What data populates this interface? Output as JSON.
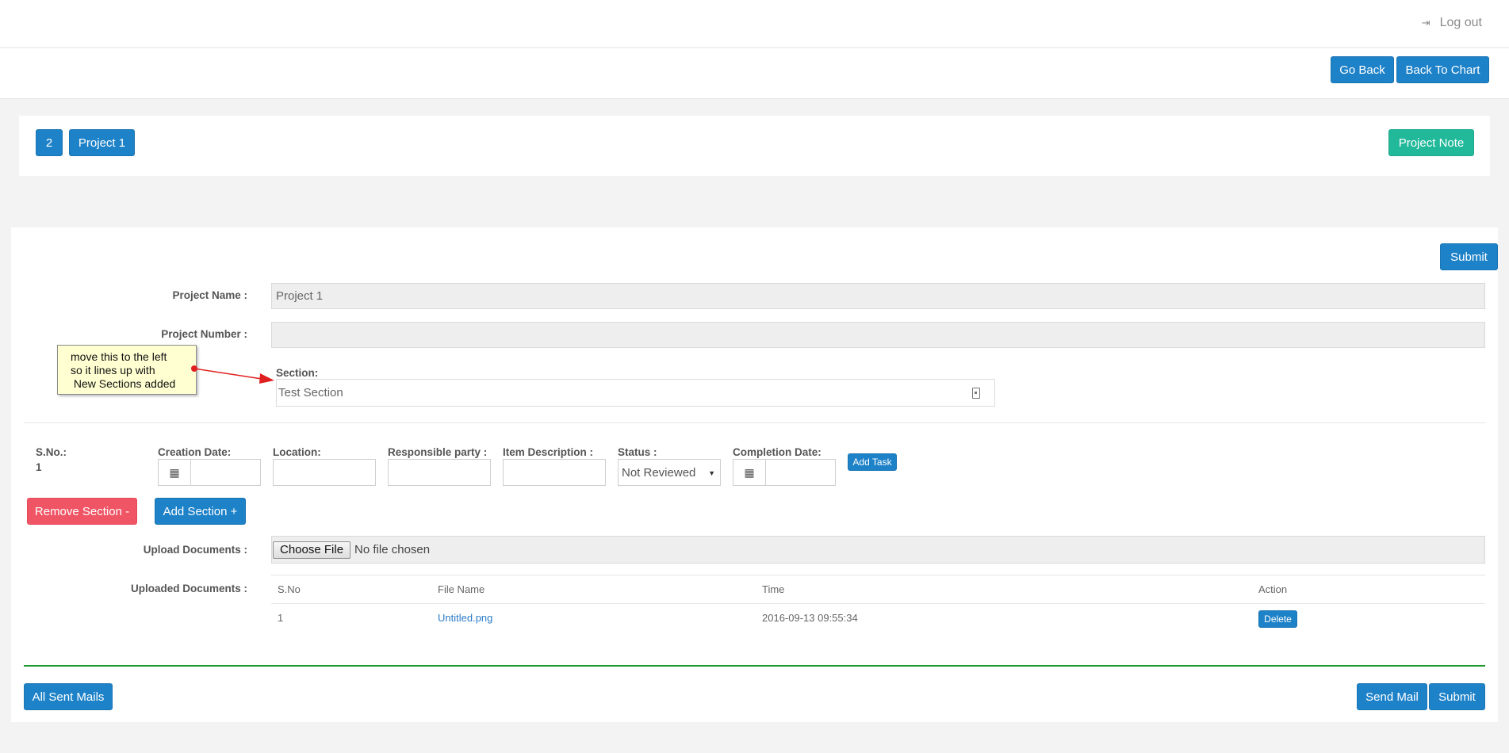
{
  "header": {
    "logout_label": "Log out",
    "logout_icon": "sign-out-icon"
  },
  "actions": {
    "go_back_label": "Go Back",
    "back_to_chart_label": "Back To Chart"
  },
  "project_bar": {
    "number_badge": "2",
    "project_label": "Project 1",
    "project_note_label": "Project Note"
  },
  "form": {
    "submit_top_label": "Submit",
    "project_name_label": "Project Name :",
    "project_name_value": "Project 1",
    "project_number_label": "Project Number :",
    "project_number_value": "",
    "section_label": "Section:",
    "section_value": "Test Section"
  },
  "task": {
    "sno_label": "S.No.:",
    "sno_value": "1",
    "creation_date_label": "Creation Date:",
    "location_label": "Location:",
    "responsible_party_label": "Responsible party :",
    "item_description_label": "Item Description :",
    "status_label": "Status :",
    "status_value": "Not Reviewed",
    "completion_date_label": "Completion Date:",
    "add_task_label": "Add Task"
  },
  "section_actions": {
    "remove_label": "Remove Section -",
    "add_label": "Add Section +"
  },
  "upload": {
    "label": "Upload Documents :",
    "choose_label": "Choose File",
    "status": "No file chosen"
  },
  "uploaded": {
    "label": "Uploaded Documents :",
    "columns": [
      "S.No",
      "File Name",
      "Time",
      "Action"
    ],
    "rows": [
      {
        "sno": "1",
        "file_name": "Untitled.png",
        "time": "2016-09-13 09:55:34",
        "action": "Delete"
      }
    ]
  },
  "footer": {
    "all_sent_mails_label": "All Sent Mails",
    "send_mail_label": "Send Mail",
    "submit_label": "Submit"
  },
  "annotation": {
    "text": "move this to the left\nso it lines up with\n New Sections added"
  },
  "colors": {
    "primary": "#1e82c8",
    "success": "#22b99a",
    "danger": "#ef5565",
    "rule": "#1e9a2c",
    "note_bg": "#ffffd2",
    "arrow": "#e02020"
  }
}
